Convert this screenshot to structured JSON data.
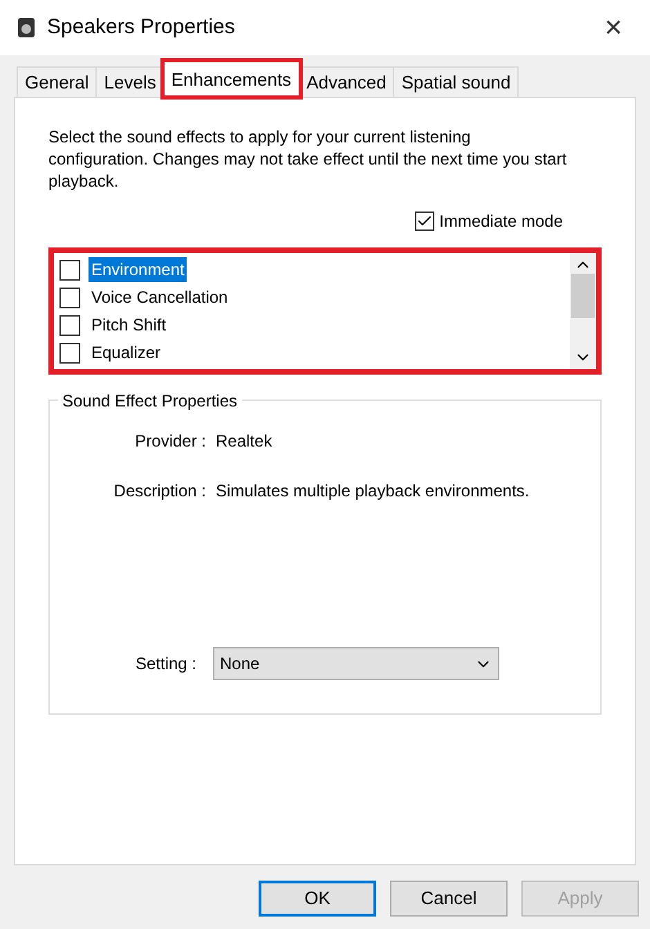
{
  "window": {
    "title": "Speakers Properties",
    "close": "×"
  },
  "tabs": [
    {
      "label": "General",
      "selected": false,
      "highlighted": false
    },
    {
      "label": "Levels",
      "selected": false,
      "highlighted": false
    },
    {
      "label": "Enhancements",
      "selected": true,
      "highlighted": true
    },
    {
      "label": "Advanced",
      "selected": false,
      "highlighted": false
    },
    {
      "label": "Spatial sound",
      "selected": false,
      "highlighted": false
    }
  ],
  "description": "Select the sound effects to apply for your current listening configuration. Changes may not take effect until the next time you start playback.",
  "immediate_mode": {
    "label": "Immediate mode",
    "checked": true
  },
  "effects_list": {
    "highlighted": true,
    "items": [
      {
        "label": "Environment",
        "checked": false,
        "selected": true
      },
      {
        "label": "Voice Cancellation",
        "checked": false,
        "selected": false
      },
      {
        "label": "Pitch Shift",
        "checked": false,
        "selected": false
      },
      {
        "label": "Equalizer",
        "checked": false,
        "selected": false
      }
    ]
  },
  "sound_effect_properties": {
    "title": "Sound Effect Properties",
    "rows": [
      {
        "label": "Provider :",
        "value": "Realtek"
      },
      {
        "label": "Description :",
        "value": "Simulates multiple playback environments."
      }
    ],
    "setting": {
      "label": "Setting :",
      "value": "None"
    }
  },
  "buttons": [
    {
      "label": "OK",
      "default": true,
      "disabled": false
    },
    {
      "label": "Cancel",
      "default": false,
      "disabled": false
    },
    {
      "label": "Apply",
      "default": false,
      "disabled": true
    }
  ]
}
